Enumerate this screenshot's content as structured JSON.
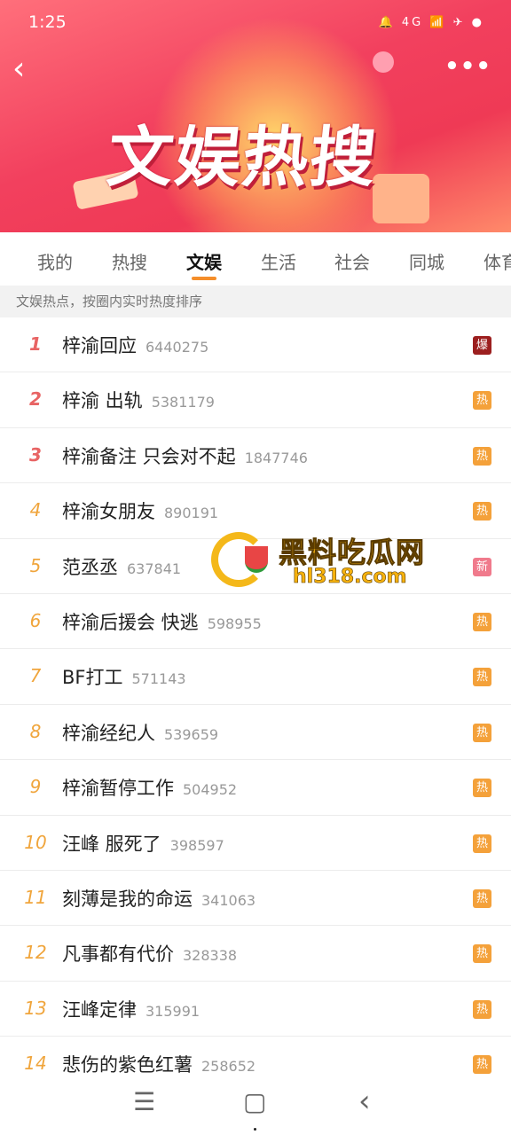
{
  "status": {
    "time": "1:25",
    "icons": "🔔 4G 📶 ✈ ●"
  },
  "header": {
    "title": "文娱热搜",
    "back": "‹",
    "more": "•••"
  },
  "tabs": [
    {
      "label": "我的"
    },
    {
      "label": "热搜"
    },
    {
      "label": "文娱"
    },
    {
      "label": "生活"
    },
    {
      "label": "社会"
    },
    {
      "label": "同城"
    },
    {
      "label": "体育"
    }
  ],
  "active_tab": "文娱",
  "subhead": "文娱热点，按圈内实时热度排序",
  "list": [
    {
      "rank": "1",
      "topic": "梓渝回应",
      "heat": "6440275",
      "badge": "爆",
      "badge_color": "#9c1f1f"
    },
    {
      "rank": "2",
      "topic": "梓渝 出轨",
      "heat": "5381179",
      "badge": "热",
      "badge_color": "#f4a13a"
    },
    {
      "rank": "3",
      "topic": "梓渝备注 只会对不起",
      "heat": "1847746",
      "badge": "热",
      "badge_color": "#f4a13a"
    },
    {
      "rank": "4",
      "topic": "梓渝女朋友",
      "heat": "890191",
      "badge": "热",
      "badge_color": "#f4a13a"
    },
    {
      "rank": "5",
      "topic": "范丞丞",
      "heat": "637841",
      "badge": "新",
      "badge_color": "#f07a8c"
    },
    {
      "rank": "6",
      "topic": "梓渝后援会 快逃",
      "heat": "598955",
      "badge": "热",
      "badge_color": "#f4a13a"
    },
    {
      "rank": "7",
      "topic": "BF打工",
      "heat": "571143",
      "badge": "热",
      "badge_color": "#f4a13a"
    },
    {
      "rank": "8",
      "topic": "梓渝经纪人",
      "heat": "539659",
      "badge": "热",
      "badge_color": "#f4a13a"
    },
    {
      "rank": "9",
      "topic": "梓渝暂停工作",
      "heat": "504952",
      "badge": "热",
      "badge_color": "#f4a13a"
    },
    {
      "rank": "10",
      "topic": "汪峰 服死了",
      "heat": "398597",
      "badge": "热",
      "badge_color": "#f4a13a"
    },
    {
      "rank": "11",
      "topic": "刻薄是我的命运",
      "heat": "341063",
      "badge": "热",
      "badge_color": "#f4a13a"
    },
    {
      "rank": "12",
      "topic": "凡事都有代价",
      "heat": "328338",
      "badge": "热",
      "badge_color": "#f4a13a"
    },
    {
      "rank": "13",
      "topic": "汪峰定律",
      "heat": "315991",
      "badge": "热",
      "badge_color": "#f4a13a"
    },
    {
      "rank": "14",
      "topic": "悲伤的紫色红薯",
      "heat": "258652",
      "badge": "热",
      "badge_color": "#f4a13a"
    }
  ],
  "watermark": {
    "name": "黑料吃瓜网",
    "url": "hl318.com"
  },
  "navbar": {
    "menu": "☰",
    "home": "▢",
    "back": "‹"
  }
}
